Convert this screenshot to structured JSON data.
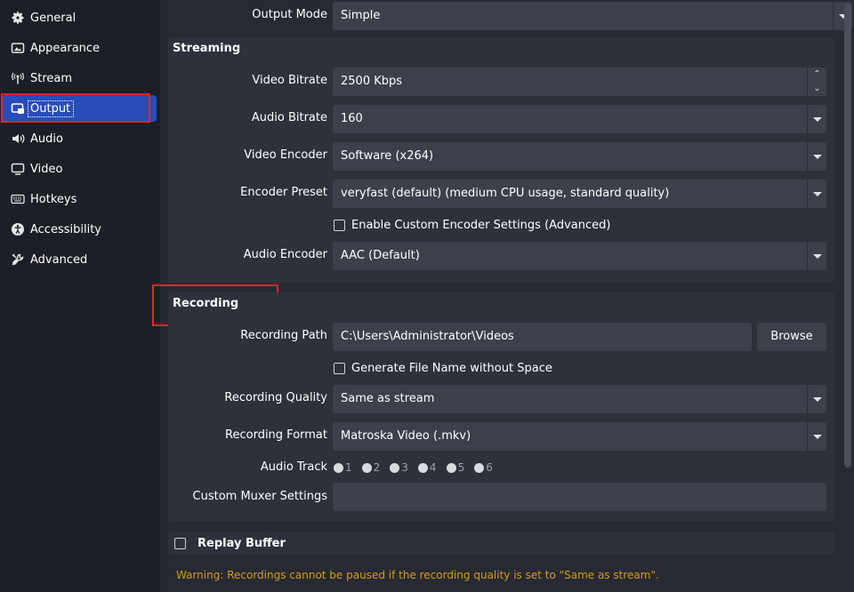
{
  "sidebar": {
    "items": [
      {
        "label": "General",
        "icon": "gear-icon"
      },
      {
        "label": "Appearance",
        "icon": "appearance-icon"
      },
      {
        "label": "Stream",
        "icon": "antenna-icon"
      },
      {
        "label": "Output",
        "icon": "output-icon",
        "active": true
      },
      {
        "label": "Audio",
        "icon": "speaker-icon"
      },
      {
        "label": "Video",
        "icon": "monitor-icon"
      },
      {
        "label": "Hotkeys",
        "icon": "keyboard-icon"
      },
      {
        "label": "Accessibility",
        "icon": "accessibility-icon"
      },
      {
        "label": "Advanced",
        "icon": "tools-icon"
      }
    ]
  },
  "output_mode": {
    "label": "Output Mode",
    "value": "Simple"
  },
  "streaming": {
    "title": "Streaming",
    "video_bitrate": {
      "label": "Video Bitrate",
      "value": "2500 Kbps"
    },
    "audio_bitrate": {
      "label": "Audio Bitrate",
      "value": "160"
    },
    "video_encoder": {
      "label": "Video Encoder",
      "value": "Software (x264)"
    },
    "encoder_preset": {
      "label": "Encoder Preset",
      "value": "veryfast (default) (medium CPU usage, standard quality)"
    },
    "custom_encoder": {
      "label": "Enable Custom Encoder Settings (Advanced)",
      "checked": false
    },
    "audio_encoder": {
      "label": "Audio Encoder",
      "value": "AAC (Default)"
    }
  },
  "recording": {
    "title": "Recording",
    "path": {
      "label": "Recording Path",
      "value": "C:\\Users\\Administrator\\Videos"
    },
    "browse_label": "Browse",
    "no_space": {
      "label": "Generate File Name without Space",
      "checked": false
    },
    "quality": {
      "label": "Recording Quality",
      "value": "Same as stream"
    },
    "format": {
      "label": "Recording Format",
      "value": "Matroska Video (.mkv)"
    },
    "audio_track": {
      "label": "Audio Track",
      "tracks": [
        "1",
        "2",
        "3",
        "4",
        "5",
        "6"
      ]
    },
    "muxer": {
      "label": "Custom Muxer Settings",
      "value": ""
    }
  },
  "replay_buffer": {
    "label": "Replay Buffer",
    "checked": false
  },
  "warning": "Warning: Recordings cannot be paused if the recording quality is set to \"Same as stream\".",
  "colors": {
    "accent": "#284cb8",
    "highlight": "#e0262f",
    "warning": "#d59b1f"
  }
}
